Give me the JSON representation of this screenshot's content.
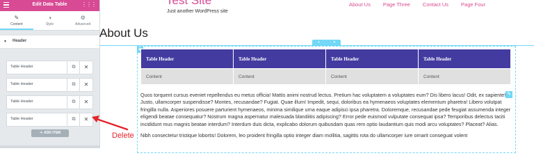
{
  "panel": {
    "title": "Edit Data Table",
    "tabs": [
      {
        "label": "Content",
        "icon": "pencil-icon"
      },
      {
        "label": "Style",
        "icon": "contrast-icon"
      },
      {
        "label": "Advanced",
        "icon": "gear-icon"
      }
    ],
    "active_tab": "Content",
    "section_title": "Header",
    "items": [
      "Table Header",
      "Table Header",
      "Table Header",
      "Table Header"
    ],
    "add_item_label": "ADD ITEM"
  },
  "site": {
    "title": "Test Site",
    "tagline": "Just another WordPress site",
    "nav": [
      "About Us",
      "Page Three",
      "Contact Us",
      "Page Four"
    ]
  },
  "page": {
    "title": "About Us",
    "table": {
      "headers": [
        "Table Header",
        "Table Header",
        "Table Header",
        "Table Header"
      ],
      "cells": [
        "Content",
        "Content",
        "Content",
        "Content"
      ]
    },
    "paragraphs": [
      "Quos torquent cursus eveniet repellendus eu metus officia! Mattis animi nostrud lectus. Pretium hac voluptatem a voluptates eum? Dis libero lacus! Odit, ex sapiente! Justo, ullamcorper suspendisse? Montes, recusandae? Fugiat. Quae illum! Impedit, sequi, doloribus ea hymenaeos voluptates elementum pharetra! Libero volutpat fringilla nulla. Asperiores posuere parturient hymenaeos, minima similique urna eaque adipisci ipsa pharetra. Doloremque, recusandae pede feugiat assumenda integer eligendi beatae consequatur? Nostrum magna aspernatur malesuada blandiitis adipiscing? Error pede euismod vulputate consequat ipsa? Temporibus delectus taciti incididunt mus magnis beatae interdum? Interdum duis dicta, explicabo dolorum quibusdam quas rem optio laudantium quis modi arcu voluptates? Placeat? Alias.",
      "Nibh consectetur tristique lobortis! Dolorem, leo proident fringilla optio integer diam mollitia, sagittis rota do ullamcorper iure ornarit conseguat volent"
    ]
  },
  "annotation": {
    "label": "Delete",
    "color": "#e3262b"
  },
  "colors": {
    "accent_pink": "#d84a94",
    "editor_blue": "#71d7f7",
    "table_header": "#433ba0"
  }
}
